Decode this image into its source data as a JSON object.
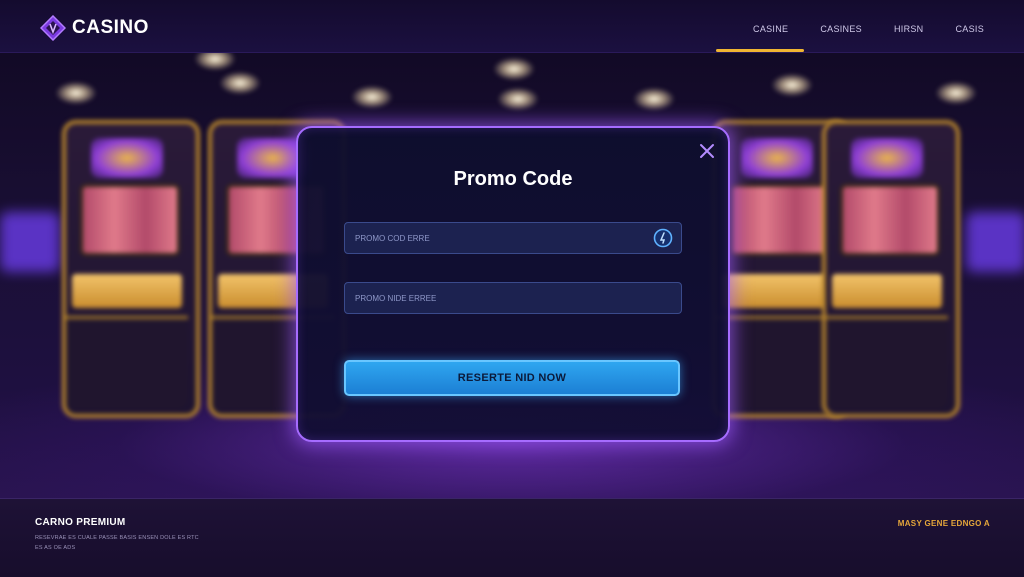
{
  "header": {
    "logo_text": "CASINO",
    "nav": [
      "CASINE",
      "CASINES",
      "HIRSN",
      "CASIS"
    ]
  },
  "modal": {
    "title": "Promo Code",
    "promo_field_placeholder": "PROMO COD ERRE",
    "second_field_placeholder": "PROMO NIDE ERREE",
    "redeem_button_label": "RESERTE NID NOW",
    "close_icon": "close-icon",
    "info_icon": "info-icon"
  },
  "footer": {
    "title": "CARNO PREMIUM",
    "line1": "RESEVRAE ES CUALE PASSE BASIS ENSEN DOLE ES RTC",
    "line2": "ES AS OE ADS",
    "right_text": "MASY GENE EDNGO A"
  },
  "colors": {
    "modal_border": "#a66cff",
    "button": "#2fa6f0",
    "accent_gold": "#f0b532",
    "background": "#0d0820"
  }
}
